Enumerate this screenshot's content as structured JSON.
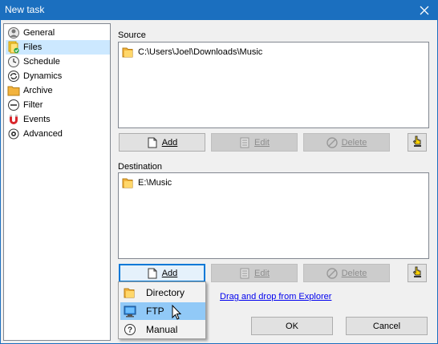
{
  "window": {
    "title": "New task"
  },
  "nav": {
    "items": [
      {
        "label": "General",
        "icon": "general-icon"
      },
      {
        "label": "Files",
        "icon": "files-icon",
        "selected": true
      },
      {
        "label": "Schedule",
        "icon": "clock-icon"
      },
      {
        "label": "Dynamics",
        "icon": "dynamics-icon"
      },
      {
        "label": "Archive",
        "icon": "archive-folder-icon"
      },
      {
        "label": "Filter",
        "icon": "filter-icon"
      },
      {
        "label": "Events",
        "icon": "magnet-icon"
      },
      {
        "label": "Advanced",
        "icon": "gear-icon"
      }
    ]
  },
  "source": {
    "label": "Source",
    "items": [
      "C:\\Users\\Joel\\Downloads\\Music"
    ],
    "add_label": "Add",
    "edit_label": "Edit",
    "delete_label": "Delete"
  },
  "destination": {
    "label": "Destination",
    "items": [
      "E:\\Music"
    ],
    "add_label": "Add",
    "edit_label": "Edit",
    "delete_label": "Delete"
  },
  "drag_link": "Drag and drop from Explorer",
  "menu": {
    "items": [
      {
        "label": "Directory",
        "icon": "folder-icon"
      },
      {
        "label": "FTP",
        "icon": "ftp-icon",
        "hover": true
      },
      {
        "label": "Manual",
        "icon": "help-icon"
      }
    ]
  },
  "footer": {
    "ok_label": "OK",
    "cancel_label": "Cancel"
  },
  "colors": {
    "titlebar": "#1b6fbf",
    "selection": "#cce8ff",
    "menu_hover": "#91c9f7",
    "link": "#0000ee"
  }
}
